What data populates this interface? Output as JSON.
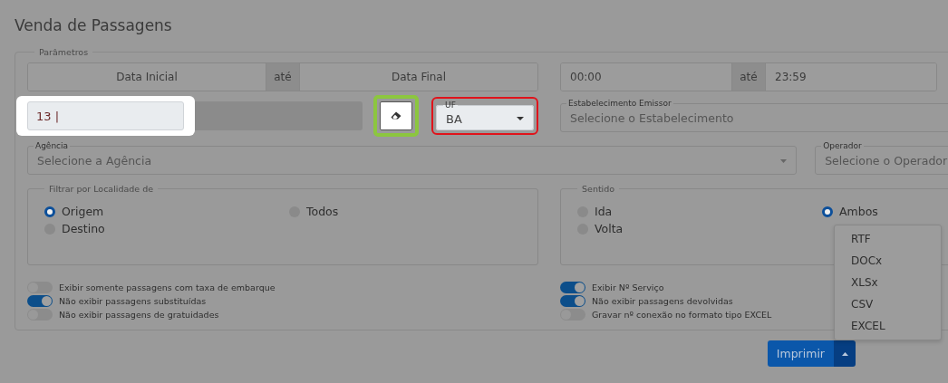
{
  "page": {
    "title": "Venda de Passagens"
  },
  "parameters": {
    "legend": "Parâmetros",
    "date_range": {
      "start_placeholder": "Data Inicial",
      "separator": "até",
      "end_placeholder": "Data Final"
    },
    "time_range": {
      "start": "00:00",
      "separator": "até",
      "end": "23:59"
    },
    "company_field": {
      "value": "13 |"
    },
    "uf": {
      "label": "UF",
      "value": "BA"
    },
    "establishment": {
      "label": "Estabelecimento Emissor",
      "placeholder": "Selecione o Estabelecimento"
    },
    "agency": {
      "label": "Agência",
      "placeholder": "Selecione a Agência"
    },
    "operator": {
      "label": "Operador",
      "placeholder": "Selecione o Operador"
    },
    "location_filter": {
      "legend": "Filtrar por Localidade de",
      "options": [
        {
          "label": "Origem",
          "selected": true
        },
        {
          "label": "Destino",
          "selected": false
        },
        {
          "label": "Todos",
          "selected": false
        }
      ]
    },
    "direction": {
      "legend": "Sentido",
      "options": [
        {
          "label": "Ida",
          "selected": false
        },
        {
          "label": "Volta",
          "selected": false
        },
        {
          "label": "Ambos",
          "selected": true
        }
      ]
    },
    "toggles_left": [
      {
        "label": "Exibir somente passagens com taxa de embarque",
        "on": false
      },
      {
        "label": "Não exibir passagens substituídas",
        "on": true
      },
      {
        "label": "Não exibir passagens de gratuidades",
        "on": false
      }
    ],
    "toggles_right": [
      {
        "label": "Exibir Nº Serviço",
        "on": true
      },
      {
        "label": "Não exibir passagens devolvidas",
        "on": true
      },
      {
        "label": "Gravar nº conexão no formato tipo EXCEL",
        "on": false
      }
    ]
  },
  "print": {
    "label": "Imprimir",
    "expanded": true,
    "menu": [
      "RTF",
      "DOCx",
      "XLSx",
      "CSV",
      "EXCEL"
    ]
  }
}
